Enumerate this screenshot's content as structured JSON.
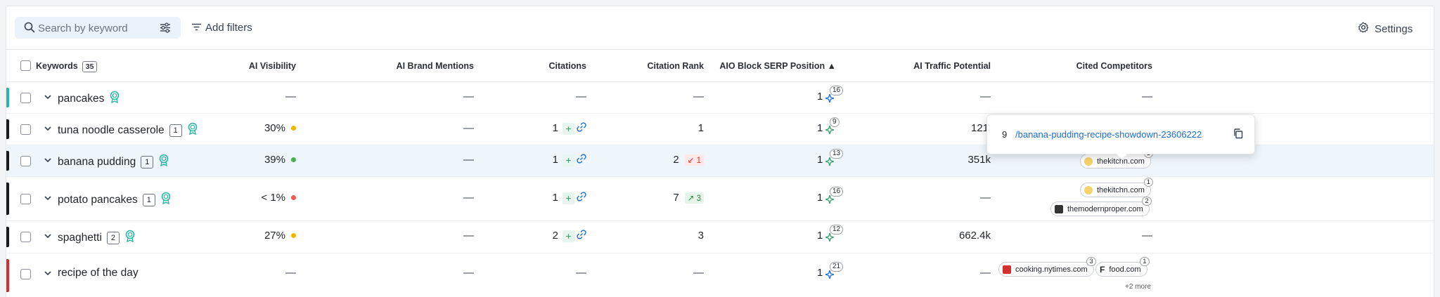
{
  "toolbar": {
    "search_placeholder": "Search by keyword",
    "add_filters_label": "Add filters",
    "settings_label": "Settings"
  },
  "columns": {
    "keywords": "Keywords",
    "keywords_count": "35",
    "ai_visibility": "AI Visibility",
    "ai_brand_mentions": "AI Brand Mentions",
    "citations": "Citations",
    "citation_rank": "Citation Rank",
    "aio_block_serp_position": "AIO Block SERP Position",
    "ai_traffic_potential": "AI Traffic Potential",
    "cited_competitors": "Cited Competitors"
  },
  "colors": {
    "accent_teal": "#2bb6a3",
    "bar_black": "#1a1a1a",
    "bar_red": "#d32f2f",
    "dot_yellow": "#f5b400",
    "dot_green": "#4caf50",
    "dot_red": "#f0594b",
    "link_blue": "#1a6ed8",
    "highlight_row": "#eef6fc"
  },
  "rows": [
    {
      "keyword": "pancakes",
      "tag": "",
      "visibility": "—",
      "brand_mentions": "—",
      "citations": "—",
      "citation_rank": "—",
      "rank_change": "",
      "serp_position": "1",
      "serp_badge": "16",
      "traffic": "—",
      "competitors_text": "—"
    },
    {
      "keyword": "tuna noodle casserole",
      "tag": "1",
      "visibility": "30%",
      "brand_mentions": "—",
      "citations": "1",
      "citation_rank": "1",
      "rank_change": "",
      "serp_position": "1",
      "serp_badge": "9",
      "traffic": "121k",
      "competitors_text": ""
    },
    {
      "keyword": "banana pudding",
      "tag": "1",
      "visibility": "39%",
      "brand_mentions": "—",
      "citations": "1",
      "citation_rank": "2",
      "rank_change": "1",
      "serp_position": "1",
      "serp_badge": "13",
      "traffic": "351k",
      "competitors": [
        {
          "domain": "thekitchn.com",
          "count": "1"
        }
      ]
    },
    {
      "keyword": "potato pancakes",
      "tag": "1",
      "visibility": "< 1%",
      "brand_mentions": "—",
      "citations": "1",
      "citation_rank": "7",
      "rank_change": "3",
      "serp_position": "1",
      "serp_badge": "16",
      "traffic": "—",
      "competitors": [
        {
          "domain": "thekitchn.com",
          "count": "1"
        },
        {
          "domain": "themodernproper.com",
          "count": "2"
        }
      ]
    },
    {
      "keyword": "spaghetti",
      "tag": "2",
      "visibility": "27%",
      "brand_mentions": "—",
      "citations": "2",
      "citation_rank": "3",
      "rank_change": "",
      "serp_position": "1",
      "serp_badge": "12",
      "traffic": "662.4k",
      "competitors_text": "—"
    },
    {
      "keyword": "recipe of the day",
      "tag": "",
      "visibility": "—",
      "brand_mentions": "—",
      "citations": "—",
      "citation_rank": "—",
      "rank_change": "",
      "serp_position": "1",
      "serp_badge": "21",
      "traffic": "—",
      "competitors": [
        {
          "domain": "cooking.nytimes.com",
          "count": "3"
        },
        {
          "domain": "food.com",
          "count": "1"
        }
      ],
      "more": "+2 more"
    }
  ],
  "popup": {
    "number": "9",
    "url": "/banana-pudding-recipe-showdown-23606222"
  }
}
